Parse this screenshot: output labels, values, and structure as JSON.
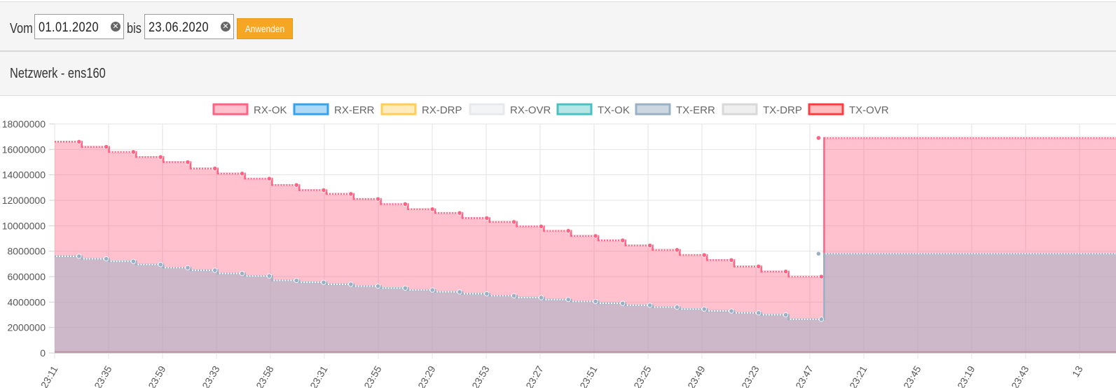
{
  "filter": {
    "from_label": "Vom",
    "from_value": "01.01.2020",
    "to_label": "bis",
    "to_value": "23.06.2020",
    "apply_label": "Anwenden",
    "clear_icon": "clear-circle-icon"
  },
  "panel": {
    "title": "Netzwerk - ens160"
  },
  "colors": {
    "accent": "#f5a623",
    "rx_ok": "#ff6384",
    "tx_err": "#9ab0c4"
  },
  "chart_data": {
    "type": "area",
    "legend_position": "top",
    "grid": true,
    "ylim": [
      0,
      18000000
    ],
    "yticks": [
      "18000000",
      "16000000",
      "14000000",
      "12000000",
      "10000000",
      "8000000",
      "6000000",
      "4000000",
      "2000000",
      "0"
    ],
    "xticks": [
      "23:11",
      "23:35",
      "23:59",
      "23:33",
      "23:58",
      "23:31",
      "23:55",
      "23:29",
      "23:53",
      "23:27",
      "23:51",
      "23:25",
      "23:49",
      "23:23",
      "23:47",
      "23:21",
      "23:45",
      "23:19",
      "23:43",
      "13"
    ],
    "series": [
      {
        "name": "RX-OK",
        "color": "#ff6384",
        "fill": "rgba(255,99,132,0.4)",
        "border": "#ff6384",
        "values": [
          16600000,
          16200000,
          15800000,
          15400000,
          15000000,
          14500000,
          14100000,
          13700000,
          13200000,
          12800000,
          12500000,
          12100000,
          11700000,
          11300000,
          11000000,
          10600000,
          10300000,
          9950000,
          9600000,
          9200000,
          8850000,
          8450000,
          8100000,
          7700000,
          7300000,
          6800000,
          6400000,
          6000000,
          16900000
        ]
      },
      {
        "name": "RX-ERR",
        "color": "#36a2eb",
        "fill": "rgba(54,162,235,0.4)",
        "border": "#36a2eb",
        "values": [
          0,
          0,
          0,
          0,
          0,
          0,
          0,
          0,
          0,
          0,
          0,
          0,
          0,
          0,
          0,
          0,
          0,
          0,
          0,
          0,
          0,
          0,
          0,
          0,
          0,
          0,
          0,
          0,
          0
        ]
      },
      {
        "name": "RX-DRP",
        "color": "#ffce56",
        "fill": "rgba(255,206,86,0.4)",
        "border": "#ffce56",
        "values": [
          0,
          0,
          0,
          0,
          0,
          0,
          0,
          0,
          0,
          0,
          0,
          0,
          0,
          0,
          0,
          0,
          0,
          0,
          0,
          0,
          0,
          0,
          0,
          0,
          0,
          0,
          0,
          0,
          0
        ]
      },
      {
        "name": "RX-OVR",
        "color": "#e7e9ed",
        "fill": "rgba(231,233,237,0.5)",
        "border": "#e7e9ed",
        "values": [
          0,
          0,
          0,
          0,
          0,
          0,
          0,
          0,
          0,
          0,
          0,
          0,
          0,
          0,
          0,
          0,
          0,
          0,
          0,
          0,
          0,
          0,
          0,
          0,
          0,
          0,
          0,
          0,
          0
        ]
      },
      {
        "name": "TX-OK",
        "color": "#4bc0c0",
        "fill": "rgba(75,192,192,0.4)",
        "border": "#4bc0c0",
        "values": [
          0,
          0,
          0,
          0,
          0,
          0,
          0,
          0,
          0,
          0,
          0,
          0,
          0,
          0,
          0,
          0,
          0,
          0,
          0,
          0,
          0,
          0,
          0,
          0,
          0,
          0,
          0,
          0,
          0
        ]
      },
      {
        "name": "TX-ERR",
        "color": "#9ab0c4",
        "fill": "rgba(154,176,196,0.5)",
        "border": "#9ab0c4",
        "values": [
          7600000,
          7400000,
          7200000,
          6950000,
          6700000,
          6500000,
          6250000,
          6050000,
          5700000,
          5550000,
          5400000,
          5250000,
          5100000,
          4950000,
          4800000,
          4650000,
          4500000,
          4350000,
          4200000,
          4050000,
          3900000,
          3750000,
          3600000,
          3450000,
          3300000,
          3150000,
          3000000,
          2650000,
          7800000
        ]
      },
      {
        "name": "TX-DRP",
        "color": "#e0e0e0",
        "fill": "rgba(224,224,224,0.5)",
        "border": "#d8d8d8",
        "values": [
          0,
          0,
          0,
          0,
          0,
          0,
          0,
          0,
          0,
          0,
          0,
          0,
          0,
          0,
          0,
          0,
          0,
          0,
          0,
          0,
          0,
          0,
          0,
          0,
          0,
          0,
          0,
          0,
          0
        ]
      },
      {
        "name": "TX-OVR",
        "color": "#ff5a5f",
        "fill": "rgba(255,90,95,0.4)",
        "border": "#ff3b3f",
        "values": [
          0,
          0,
          0,
          0,
          0,
          0,
          0,
          0,
          0,
          0,
          0,
          0,
          0,
          0,
          0,
          0,
          0,
          0,
          0,
          0,
          0,
          0,
          0,
          0,
          0,
          0,
          0,
          0,
          0
        ]
      }
    ]
  }
}
